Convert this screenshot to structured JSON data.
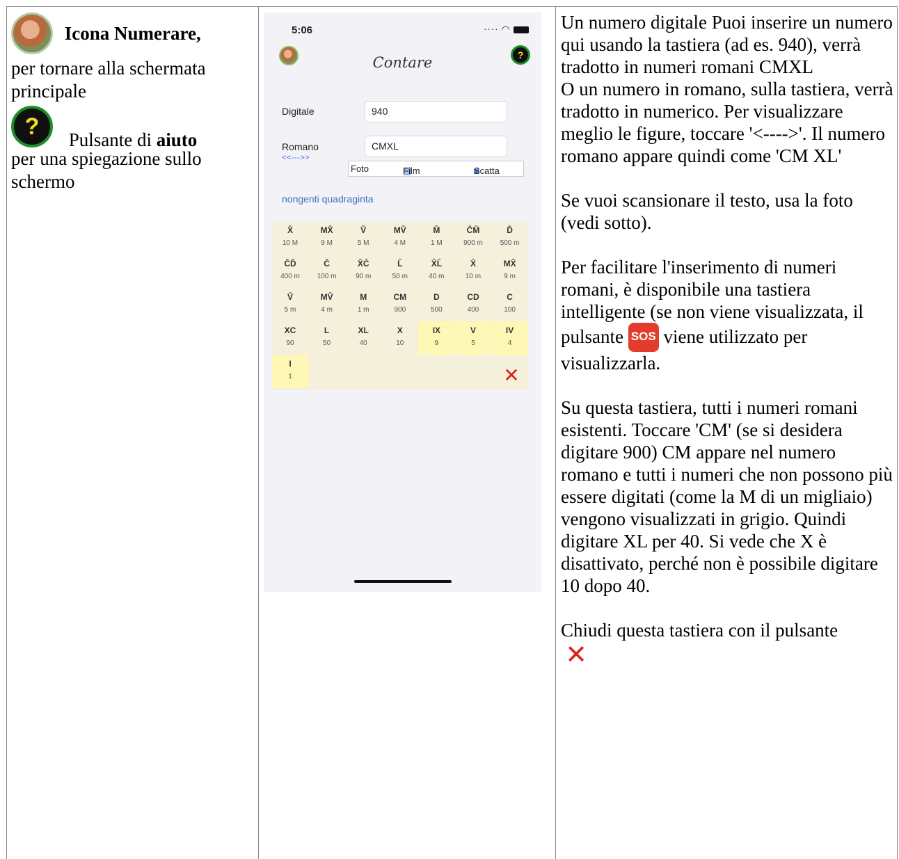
{
  "left_column": {
    "icon_title": "Icona Numerare,",
    "icon_desc": "per tornare alla schermata principale",
    "help_text_pre": "Pulsante di ",
    "help_text_bold": "aiuto",
    "help_text_post": "per una spiegazione sullo schermo"
  },
  "phone": {
    "status_time": "5:06",
    "title": "Contare",
    "digital_label": "Digitale",
    "digital_value": "940",
    "roman_label": "Romano",
    "roman_value": "CMXL",
    "arrows": "<<--->>",
    "photo_bar": {
      "foto": "Foto",
      "film": "Film",
      "scatta": "Scatta"
    },
    "number_words": "nongenti quadraginta",
    "keyboard": [
      [
        {
          "s": "X̄",
          "v": "10 M"
        },
        {
          "s": "MX̄",
          "v": "9 M"
        },
        {
          "s": "V̄",
          "v": "5 M"
        },
        {
          "s": "MV̄",
          "v": "4 M"
        },
        {
          "s": "M̄",
          "v": "1 M"
        },
        {
          "s": "C̄M̄",
          "v": "900 m"
        },
        {
          "s": "D̄",
          "v": "500 m"
        }
      ],
      [
        {
          "s": "C̄D̄",
          "v": "400 m"
        },
        {
          "s": "C̄",
          "v": "100 m"
        },
        {
          "s": "X̄C̄",
          "v": "90 m"
        },
        {
          "s": "L̄",
          "v": "50 m"
        },
        {
          "s": "X̄L̄",
          "v": "40 m"
        },
        {
          "s": "X̄",
          "v": "10 m"
        },
        {
          "s": "MX̄",
          "v": "9 m"
        }
      ],
      [
        {
          "s": "V̄",
          "v": "5 m"
        },
        {
          "s": "MV̄",
          "v": "4 m"
        },
        {
          "s": "M",
          "v": "1 m"
        },
        {
          "s": "CM",
          "v": "900"
        },
        {
          "s": "D",
          "v": "500"
        },
        {
          "s": "CD",
          "v": "400"
        },
        {
          "s": "C",
          "v": "100"
        }
      ],
      [
        {
          "s": "XC",
          "v": "90"
        },
        {
          "s": "L",
          "v": "50"
        },
        {
          "s": "XL",
          "v": "40"
        },
        {
          "s": "X",
          "v": "10"
        },
        {
          "s": "IX",
          "v": "9"
        },
        {
          "s": "V",
          "v": "5"
        },
        {
          "s": "IV",
          "v": "4"
        }
      ],
      [
        {
          "s": "I",
          "v": "1"
        }
      ]
    ]
  },
  "right_column": {
    "p1": "Un numero digitale Puoi inserire un numero qui usando la tastiera (ad es. 940), verrà tradotto in numeri romani CMXL",
    "p2": "O un numero in romano, sulla tastiera, verrà tradotto in numerico. Per visualizzare meglio le figure, toccare '<---->'. Il numero romano appare quindi come 'CM XL'",
    "p3": "Se vuoi scansionare il testo, usa la foto (vedi sotto).",
    "p4a": "Per facilitare l'inserimento di numeri romani, è disponibile una tastiera intelligente (se non viene visualizzata, il pulsante ",
    "sos": "SOS",
    "p4b": "viene utilizzato per visualizzarla.",
    "p5": "Su questa tastiera, tutti i numeri romani esistenti. Toccare 'CM' (se si desidera digitare 900) CM appare nel numero romano e tutti i numeri che non possono più essere digitati (come la M di un migliaio) vengono visualizzati in grigio. Quindi digitare XL per 40. Si vede che X è disattivato, perché non è possibile digitare 10 dopo 40.",
    "p6": "Chiudi questa tastiera con il pulsante"
  },
  "icons": {
    "avatar": "numerare-avatar-icon",
    "help": "help-question-icon",
    "close": "close-x-icon",
    "sos": "sos-icon"
  },
  "colors": {
    "help_green": "#1e8f25",
    "help_yellow": "#f1dc1e",
    "close_red": "#d8261b",
    "sos_red": "#e23c2c",
    "keyboard_bg": "#f4f0dc",
    "key_highlight": "#fff7b5",
    "link_blue": "#3b6fc0"
  }
}
